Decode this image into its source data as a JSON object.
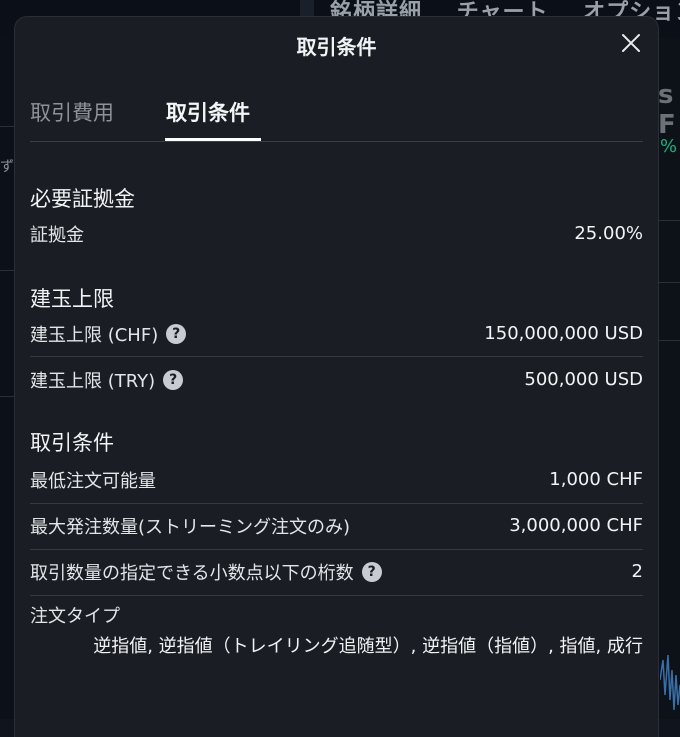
{
  "background": {
    "tabs": [
      "銘柄詳細",
      "チャート",
      "オプション"
    ],
    "right_fragment": "s F",
    "right_percent": "%"
  },
  "modal": {
    "title": "取引条件",
    "tabs": [
      {
        "label": "取引費用",
        "active": false
      },
      {
        "label": "取引条件",
        "active": true
      }
    ]
  },
  "sections": {
    "margin": {
      "heading": "必要証拠金",
      "rows": [
        {
          "label": "証拠金",
          "value": "25.00%"
        }
      ]
    },
    "position_limit": {
      "heading": "建玉上限",
      "rows": [
        {
          "label": "建玉上限 (CHF)",
          "value": "150,000,000 USD",
          "help": true
        },
        {
          "label": "建玉上限 (TRY)",
          "value": "500,000 USD",
          "help": true
        }
      ]
    },
    "trading": {
      "heading": "取引条件",
      "rows": [
        {
          "label": "最低注文可能量",
          "value": "1,000 CHF"
        },
        {
          "label": "最大発注数量(ストリーミング注文のみ)",
          "value": "3,000,000 CHF"
        },
        {
          "label": "取引数量の指定できる小数点以下の桁数",
          "value": "2",
          "help": true
        }
      ],
      "order_type_label": "注文タイプ",
      "order_type_value": "逆指値, 逆指値（トレイリング追随型）, 逆指値（指値）, 指値, 成行"
    }
  },
  "colors": {
    "modal_bg": "#1a1e24",
    "page_bg": "#0f141d",
    "divider": "#363b43",
    "inactive_tab": "#8d929a"
  },
  "icons": {
    "close": "close-icon",
    "help": "question-circle-icon",
    "expand": "expand-icon"
  }
}
